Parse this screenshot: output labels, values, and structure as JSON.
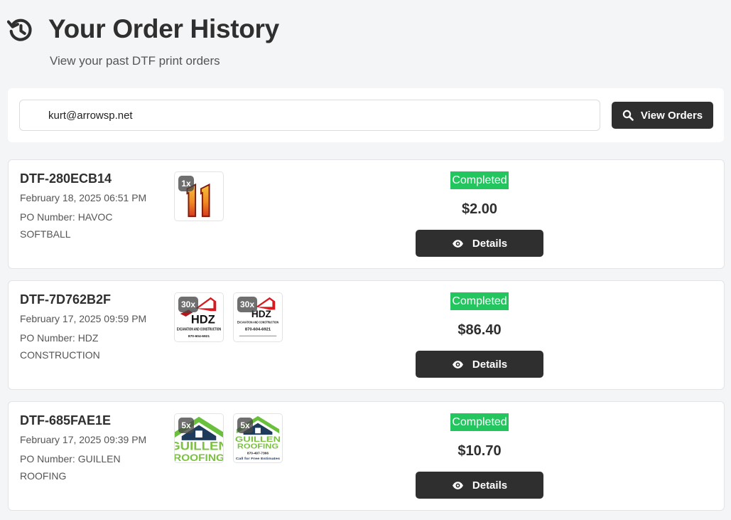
{
  "header": {
    "title": "Your Order History",
    "subtitle": "View your past DTF print orders",
    "icon": "history-icon"
  },
  "search": {
    "email_value": "kurt@arrowsp.net",
    "button_label": "View Orders",
    "button_icon": "search-icon"
  },
  "orders": [
    {
      "id": "DTF-280ECB14",
      "date": "February 18, 2025 06:51 PM",
      "po": "PO Number: HAVOC SOFTBALL",
      "status": "Completed",
      "total": "$2.00",
      "details_label": "Details",
      "items": [
        {
          "qty": "1x",
          "thumbnail": "number-11-design"
        }
      ]
    },
    {
      "id": "DTF-7D762B2F",
      "date": "February 17, 2025 09:59 PM",
      "po": "PO Number: HDZ CONSTRUCTION",
      "status": "Completed",
      "total": "$86.40",
      "details_label": "Details",
      "items": [
        {
          "qty": "30x",
          "thumbnail": "hdz-logo",
          "logo_text": "HDZ",
          "logo_sub": "EXCAVATION AND CONSTRUCTION",
          "logo_phone": "870-604-6921"
        },
        {
          "qty": "30x",
          "thumbnail": "hdz-logo",
          "logo_text": "HDZ",
          "logo_sub": "EXCAVATION AND CONSTRUCTION",
          "logo_phone": "870-604-6921"
        }
      ]
    },
    {
      "id": "DTF-685FAE1E",
      "date": "February 17, 2025 09:39 PM",
      "po": "PO Number: GUILLEN ROOFING",
      "status": "Completed",
      "total": "$10.70",
      "details_label": "Details",
      "items": [
        {
          "qty": "5x",
          "thumbnail": "guillen-roofing-logo",
          "logo_text": "GUILLEN",
          "logo_sub": "ROOFING"
        },
        {
          "qty": "5x",
          "thumbnail": "guillen-roofing-logo",
          "logo_text": "GUILLEN",
          "logo_sub": "ROOFING",
          "logo_phone": "870-497-7366",
          "logo_note": "Call for Free Estimates"
        }
      ]
    }
  ],
  "colors": {
    "background": "#f4f5f7",
    "button": "#2f2f2f",
    "status_completed": "#22c55e",
    "card": "#ffffff"
  }
}
